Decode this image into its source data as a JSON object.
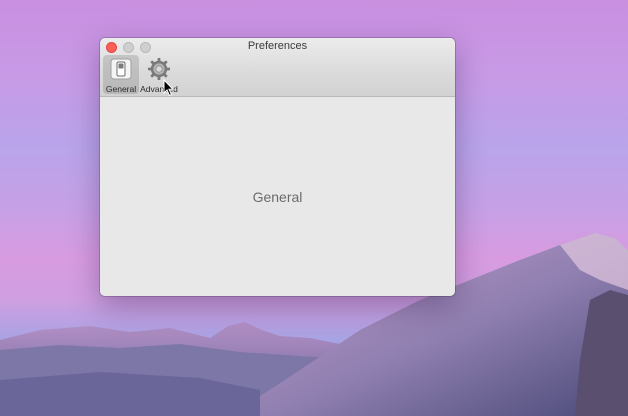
{
  "window": {
    "title": "Preferences"
  },
  "toolbar": {
    "items": [
      {
        "label": "General",
        "icon": "switch-icon",
        "selected": true
      },
      {
        "label": "Advanced",
        "icon": "gear-icon",
        "selected": false
      }
    ]
  },
  "content": {
    "label": "General"
  },
  "colors": {
    "close_button": "#fc5f57",
    "window_background": "#e8e8e8"
  }
}
